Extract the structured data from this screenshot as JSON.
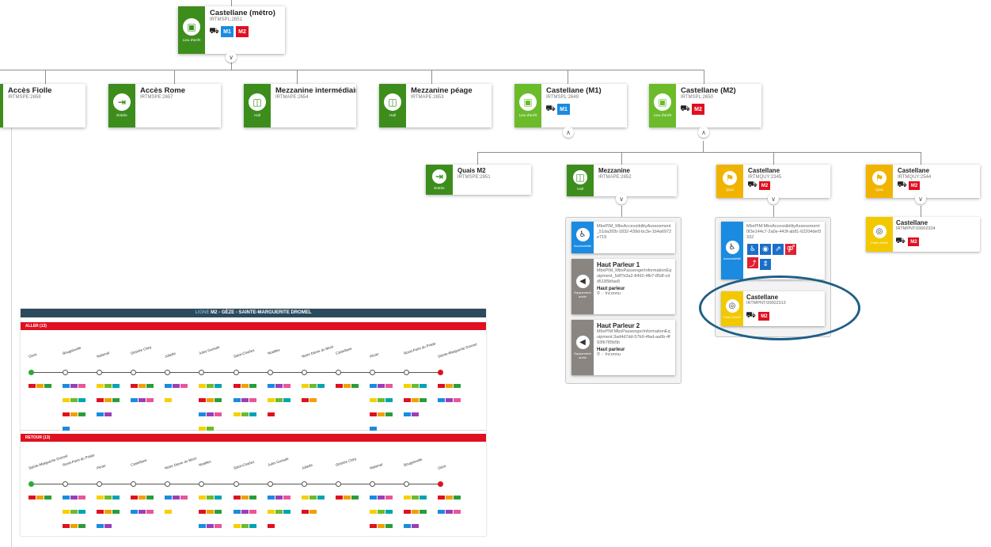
{
  "root": {
    "title": "Castellane (métro)",
    "code": "IRTMSPL:2651",
    "caption": "Lieu d'arrêt",
    "badges": [
      "M1",
      "M2"
    ]
  },
  "level2": [
    {
      "title": "Accès Fiolle",
      "code": "IRTMSPE:2658",
      "caption": ""
    },
    {
      "title": "Accès Rome",
      "code": "IRTMSPE:2657",
      "caption": "Entrée"
    },
    {
      "title": "Mezzanine intermédiaire",
      "code": "IRTMAPE:2654",
      "caption": "Hall"
    },
    {
      "title": "Mezzanine péage",
      "code": "IRTMAPE:2653",
      "caption": "Hall"
    },
    {
      "title": "Castellane (M1)",
      "code": "IRTMSPL:2649",
      "caption": "Lieu d'arrêt",
      "badges": [
        "M1"
      ]
    },
    {
      "title": "Castellane (M2)",
      "code": "IRTMSPL:2650",
      "caption": "Lieu d'arrêt",
      "badges": [
        "M2"
      ]
    }
  ],
  "level3": [
    {
      "title": "Quais M2",
      "code": "IRTMSPE:2651",
      "caption": "Entrée"
    },
    {
      "title": "Mezzanine",
      "code": "IRTMAPE:2652",
      "caption": "Hall"
    },
    {
      "title": "Castellane",
      "code": "IRTMQUY:2345",
      "caption": "Quai",
      "badges": [
        "M2"
      ]
    },
    {
      "title": "Castellane",
      "code": "IRTMQUY:2544",
      "caption": "Quai",
      "badges": [
        "M2"
      ]
    }
  ],
  "mezzanine_children": [
    {
      "type": "accessibility",
      "caption": "Accessibilité",
      "text": "MbxPIM_MbxAccessibilityAssessment_51da3f2b-1832-439d-bc3e-1b4a6972e719"
    },
    {
      "type": "audio",
      "caption": "Equipement audio",
      "title": "Haut Parleur 1",
      "text": "MbxPIM_MbxPassengerInformationEquipment_5df7b3a2-8492-4fb7-85df-cdd5185bfae8",
      "label": "Haut parleur",
      "status": "Inconnu"
    },
    {
      "type": "audio",
      "caption": "Equipement audio",
      "title": "Haut Parleur 2",
      "text": "MbxPIM:MbxPassengerInformationEquipment:3ad4d7dd-57b9-4fad-aa0b-4f93fb785b5b",
      "label": "Haut parleur",
      "status": "Inconnu"
    }
  ],
  "quai_children": [
    {
      "type": "accessibility",
      "caption": "Accessibilité",
      "text": "MbxPIM:MbxAccessibilityAssessment:0f3e144c7-2a0e-443f-ab81-62204def3332"
    },
    {
      "type": "stop",
      "caption": "Point d'arrêt",
      "title": "Castellane",
      "code": "IRTMPNT:00002313",
      "badges": [
        "M2"
      ]
    }
  ],
  "quai2_child": {
    "caption": "Point d'arrêt",
    "title": "Castellane",
    "code": "IRTMPNT:00002324",
    "badges": [
      "M2"
    ]
  },
  "line_sheet": {
    "label": "LIGNE",
    "title": "M2 - GÈZE - SAINTE-MARGUERITE DROMEL",
    "aller": "ALLER (13)",
    "retour": "RETOUR (13)",
    "stops_aller": [
      "Gèze",
      "Bougainville",
      "National",
      "Désirée Clary",
      "Joliette",
      "Jules Guesde",
      "Saint-Charles",
      "Noailles",
      "Notre Dame du Mont",
      "Castellane",
      "Périer",
      "Rond-Point du Prado",
      "Sainte-Marguerite Dromel"
    ],
    "stops_retour": [
      "Sainte-Marguerite Dromel",
      "Rond-Point du Prado",
      "Périer",
      "Castellane",
      "Notre Dame du Mont",
      "Noailles",
      "Saint-Charles",
      "Jules Guesde",
      "Joliette",
      "Désirée Clary",
      "National",
      "Bougainville",
      "Gèze"
    ]
  },
  "colors": {
    "green_light": "#6bbb2b",
    "green_dark": "#3d8d1c",
    "yellow": "#f0b400",
    "m1": "#1a8be0",
    "m2": "#e01020",
    "highlight": "#1e5f86"
  }
}
